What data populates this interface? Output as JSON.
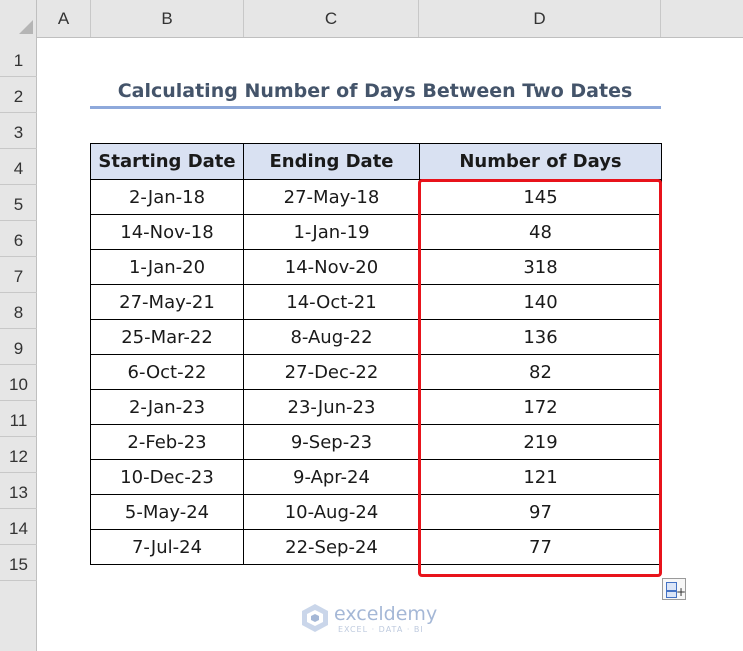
{
  "columns": [
    "A",
    "B",
    "C",
    "D"
  ],
  "rows": [
    "1",
    "2",
    "3",
    "4",
    "5",
    "6",
    "7",
    "8",
    "9",
    "10",
    "11",
    "12",
    "13",
    "14",
    "15"
  ],
  "title": "Calculating Number of Days Between Two Dates",
  "table": {
    "headers": [
      "Starting Date",
      "Ending Date",
      "Number of Days"
    ],
    "rows": [
      [
        "2-Jan-18",
        "27-May-18",
        "145"
      ],
      [
        "14-Nov-18",
        "1-Jan-19",
        "48"
      ],
      [
        "1-Jan-20",
        "14-Nov-20",
        "318"
      ],
      [
        "27-May-21",
        "14-Oct-21",
        "140"
      ],
      [
        "25-Mar-22",
        "8-Aug-22",
        "136"
      ],
      [
        "6-Oct-22",
        "27-Dec-22",
        "82"
      ],
      [
        "2-Jan-23",
        "23-Jun-23",
        "172"
      ],
      [
        "2-Feb-23",
        "9-Sep-23",
        "219"
      ],
      [
        "10-Dec-23",
        "9-Apr-24",
        "121"
      ],
      [
        "5-May-24",
        "10-Aug-24",
        "97"
      ],
      [
        "7-Jul-24",
        "22-Sep-24",
        "77"
      ]
    ]
  },
  "watermark": {
    "name": "exceldemy",
    "tagline": "EXCEL · DATA · BI"
  },
  "colors": {
    "header_fill": "#d9e1f2",
    "title_text": "#44546a",
    "title_underline": "#8ea9db",
    "highlight_border": "#e8131b"
  },
  "icons": {
    "paste_options": "paste-options-icon"
  }
}
